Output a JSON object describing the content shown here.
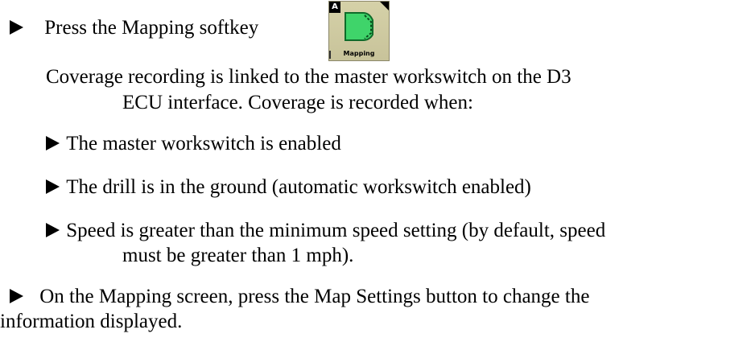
{
  "step1": {
    "text": "Press the Mapping softkey"
  },
  "softkey": {
    "badge": "A",
    "label": "Mapping"
  },
  "coverage": {
    "line1": "Coverage recording is linked to the master workswitch on the D3",
    "line2": "ECU interface. Coverage is recorded when:"
  },
  "conditions": [
    {
      "text": "The master workswitch is enabled"
    },
    {
      "text": "The drill is in the ground (automatic workswitch enabled)"
    },
    {
      "line1": "Speed is greater than the minimum speed setting (by default, speed",
      "line2": "must be greater than 1 mph)."
    }
  ],
  "step2": {
    "line1": "On the Mapping screen, press the Map Settings button to change the",
    "line2": "information displayed."
  }
}
